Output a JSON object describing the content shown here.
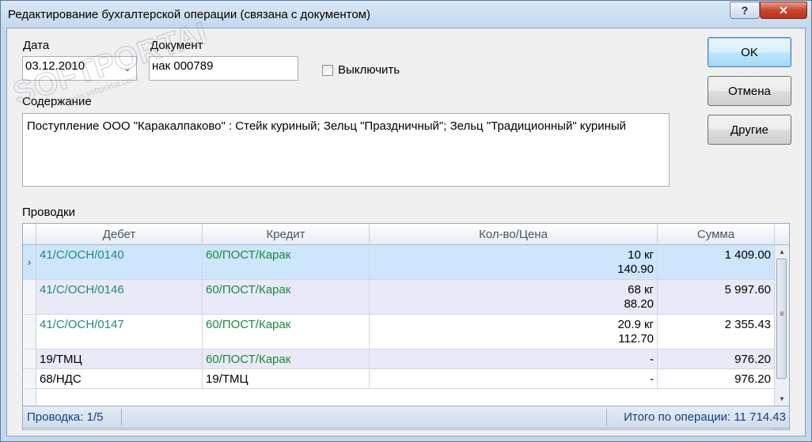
{
  "window": {
    "title": "Редактирование бухгалтерской операции (связана с документом)",
    "help_label": "?",
    "close_label": "✕"
  },
  "form": {
    "date_label": "Дата",
    "date_value": "03.12.2010",
    "document_label": "Документ",
    "document_value": "нак 000789",
    "disable_label": "Выключить",
    "content_label": "Содержание",
    "content_value": "Поступление ООО \"Каракалпаково\" : Стейк куриный; Зельц \"Праздничный\"; Зельц \"Традиционный\" куриный",
    "entries_label": "Проводки"
  },
  "buttons": {
    "ok": "OK",
    "cancel": "Отмена",
    "other": "Другие"
  },
  "grid": {
    "columns": [
      "Дебет",
      "Кредит",
      "Кол-во/Цена",
      "Сумма"
    ],
    "rows": [
      {
        "debit": "41/С/ОСН/0140",
        "credit": "60/ПОСТ/Карак",
        "qty": "10 кг",
        "price": "140.90",
        "sum": "1 409.00"
      },
      {
        "debit": "41/С/ОСН/0146",
        "credit": "60/ПОСТ/Карак",
        "qty": "68 кг",
        "price": "88.20",
        "sum": "5 997.60"
      },
      {
        "debit": "41/С/ОСН/0147",
        "credit": "60/ПОСТ/Карак",
        "qty": "20.9 кг",
        "price": "112.70",
        "sum": "2 355.43"
      },
      {
        "debit": "19/ТМЦ",
        "credit": "60/ПОСТ/Карак",
        "qty": "-",
        "price": "",
        "sum": "976.20"
      },
      {
        "debit": "68/НДС",
        "credit": "19/ТМЦ",
        "qty": "-",
        "price": "",
        "sum": "976.20"
      }
    ]
  },
  "status": {
    "left": "Проводка: 1/5",
    "right": "Итого по операции: 11 714.43"
  },
  "watermark": {
    "brand": "SOFTPORTAL",
    "url": "www.softportal.com"
  },
  "colors": {
    "accent": "#3c7fb1",
    "selected_row": "#cde6fb",
    "alt_row": "#e9e9f8",
    "green_text": "#1b8a3a",
    "teal_text": "#1f8a82",
    "status_text": "#1e3d76"
  }
}
